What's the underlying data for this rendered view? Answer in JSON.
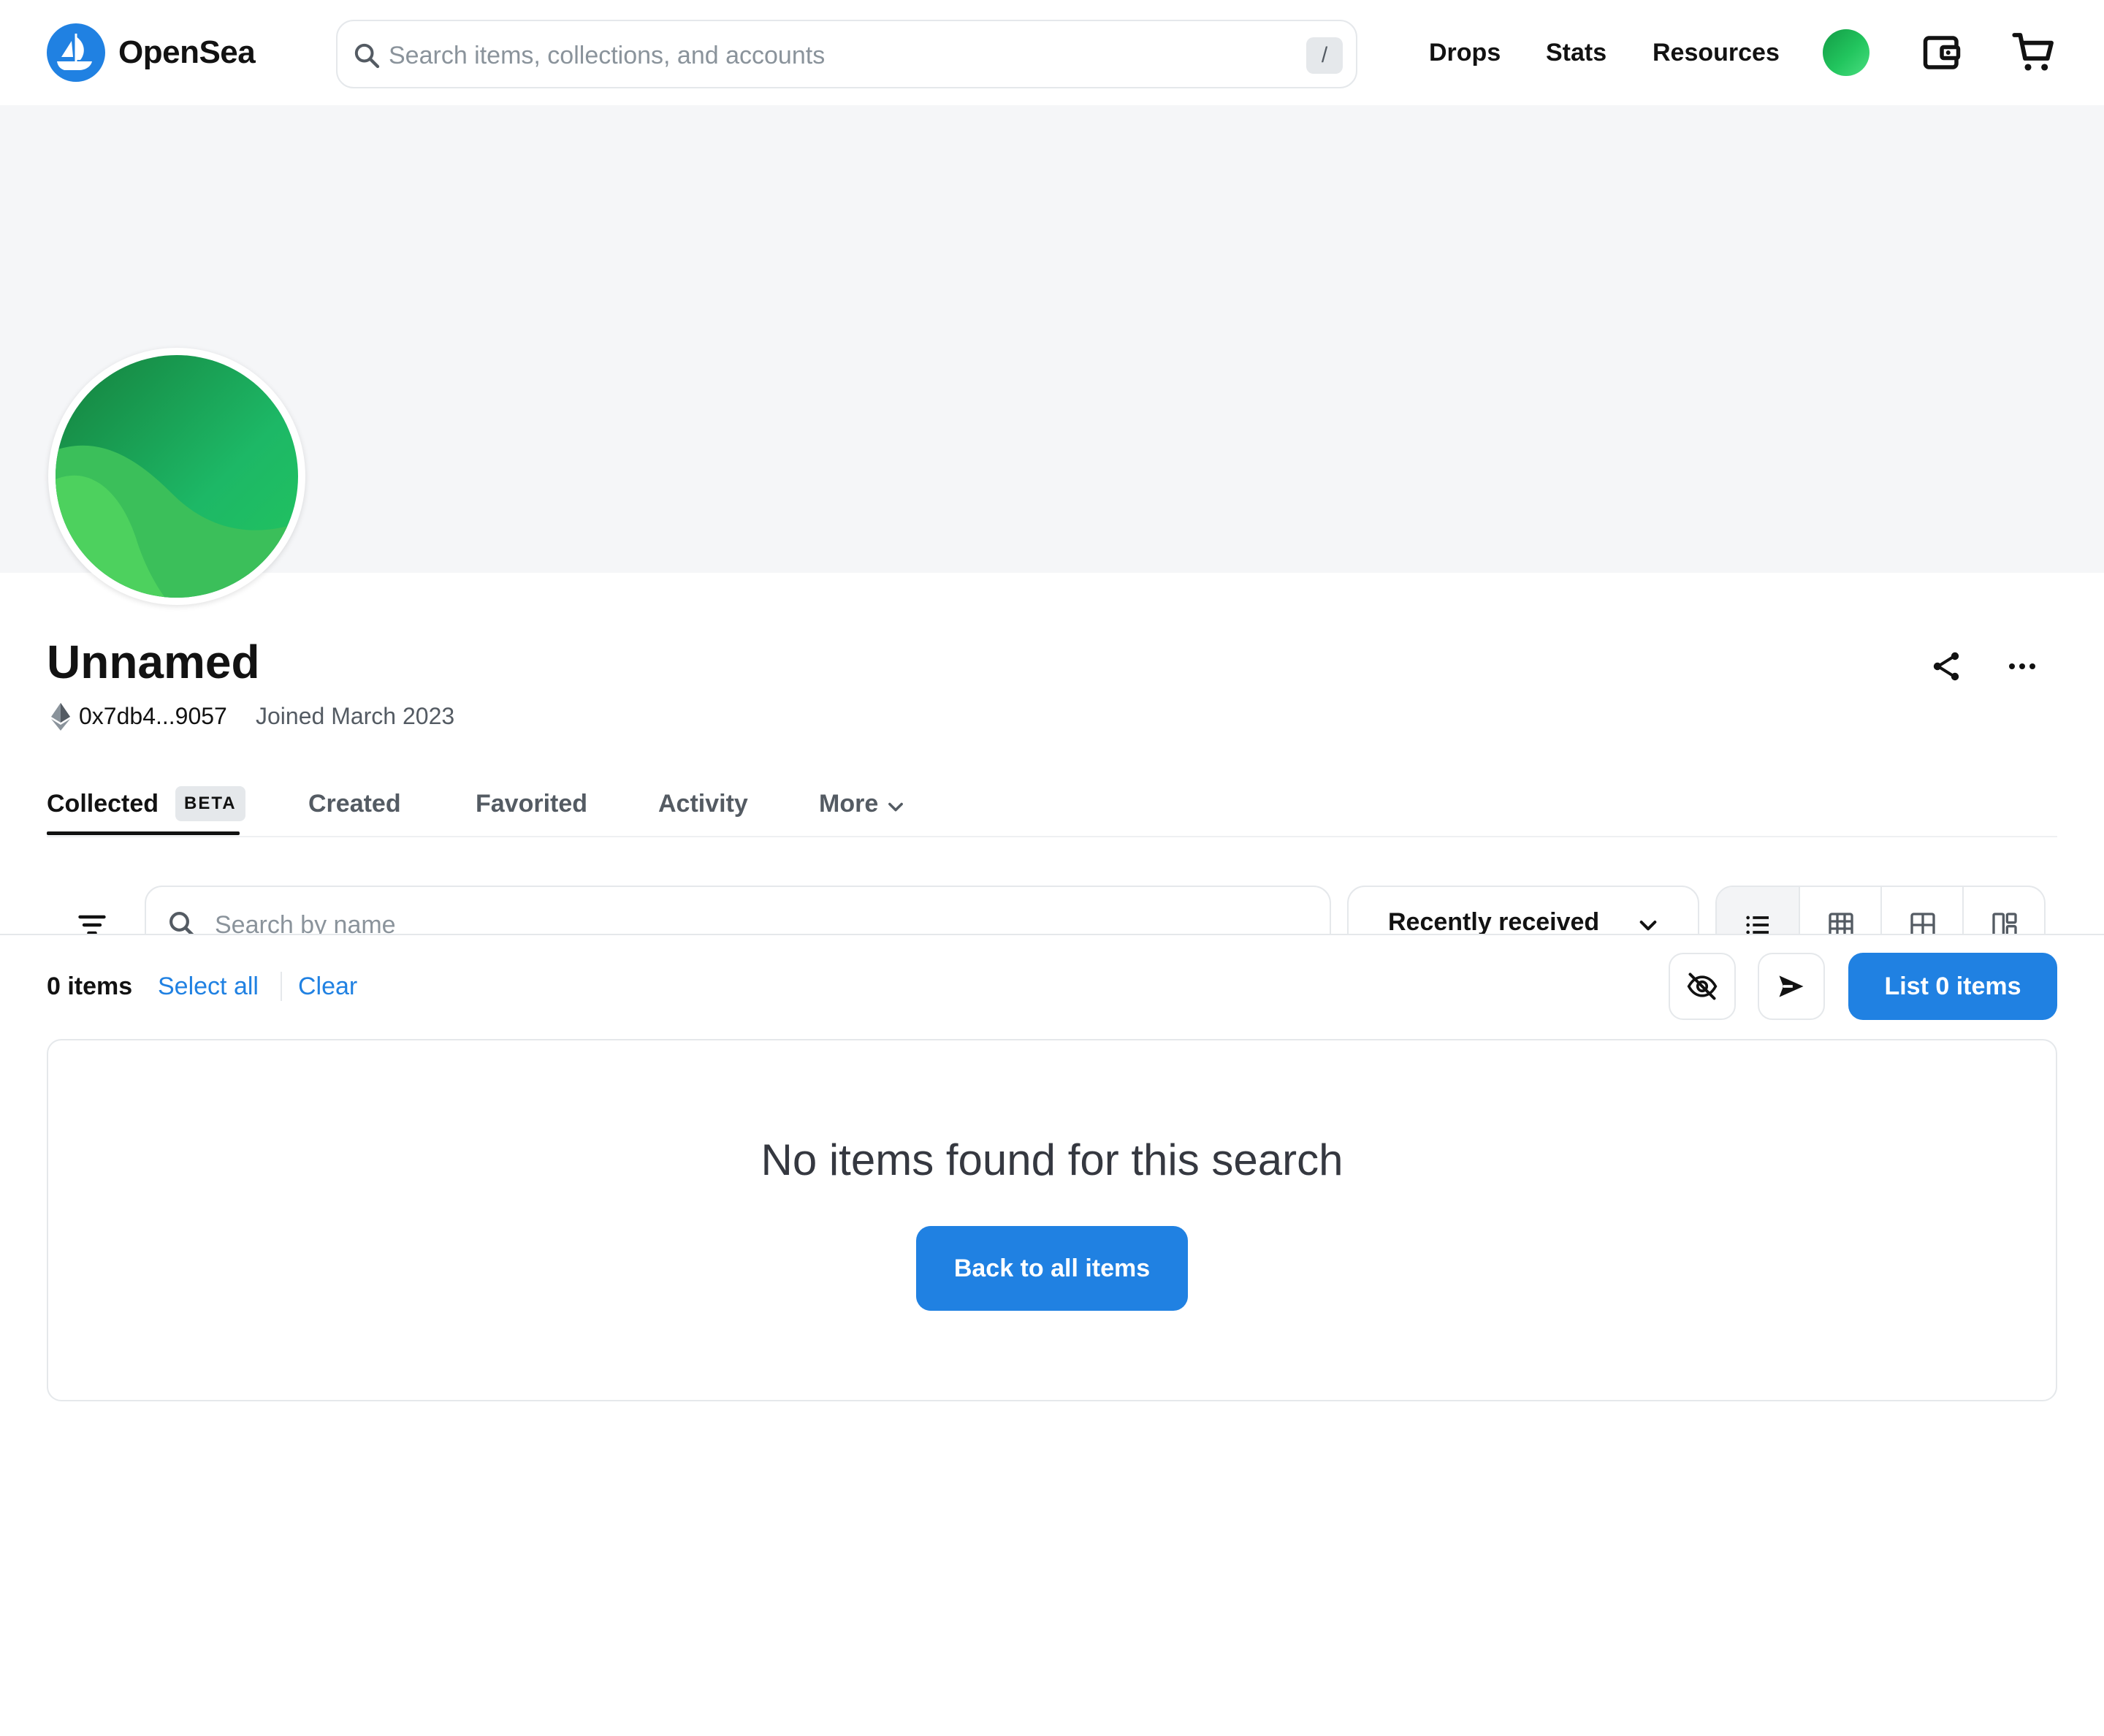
{
  "header": {
    "brand": "OpenSea",
    "search_placeholder": "Search items, collections, and accounts",
    "search_shortcut": "/",
    "nav": [
      "Drops",
      "Stats",
      "Resources"
    ]
  },
  "profile": {
    "name": "Unnamed",
    "address": "0x7db4...9057",
    "joined": "Joined March 2023"
  },
  "tabs": {
    "items": [
      "Collected",
      "Created",
      "Favorited",
      "Activity",
      "More"
    ],
    "badge": "BETA",
    "active": "Collected"
  },
  "toolbar": {
    "search_placeholder": "Search by name",
    "sort": "Recently received"
  },
  "selection": {
    "count": "0 items",
    "select_all": "Select all",
    "clear": "Clear",
    "list_button": "List 0 items"
  },
  "empty_state": {
    "message": "No items found for this search",
    "back_button": "Back to all items"
  },
  "colors": {
    "accent": "#2081e2",
    "text": "#121212",
    "muted": "#545b63",
    "banner": "#f5f6f8"
  }
}
